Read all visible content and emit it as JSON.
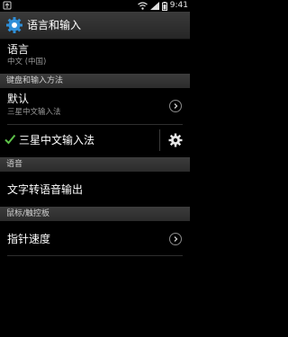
{
  "status_bar": {
    "time": "9:41",
    "icons": [
      "usb-icon",
      "wifi-icon",
      "signal-icon",
      "battery-icon"
    ]
  },
  "action_bar": {
    "title": "语言和输入",
    "icon": "settings-icon"
  },
  "items": {
    "language": {
      "title": "语言",
      "subtitle": "中文 (中国)"
    },
    "default_ime": {
      "title": "默认",
      "subtitle": "三星中文输入法"
    },
    "samsung_ime": {
      "title": "三星中文输入法",
      "checked": true
    },
    "tts": {
      "title": "文字转语音输出"
    },
    "pointer_speed": {
      "title": "指针速度"
    }
  },
  "sections": {
    "keyboard": "键盘和输入方法",
    "speech": "语音",
    "mouse": "鼠标/触控板"
  },
  "colors": {
    "accent": "#2f8fd8",
    "check": "#5ec24a"
  }
}
